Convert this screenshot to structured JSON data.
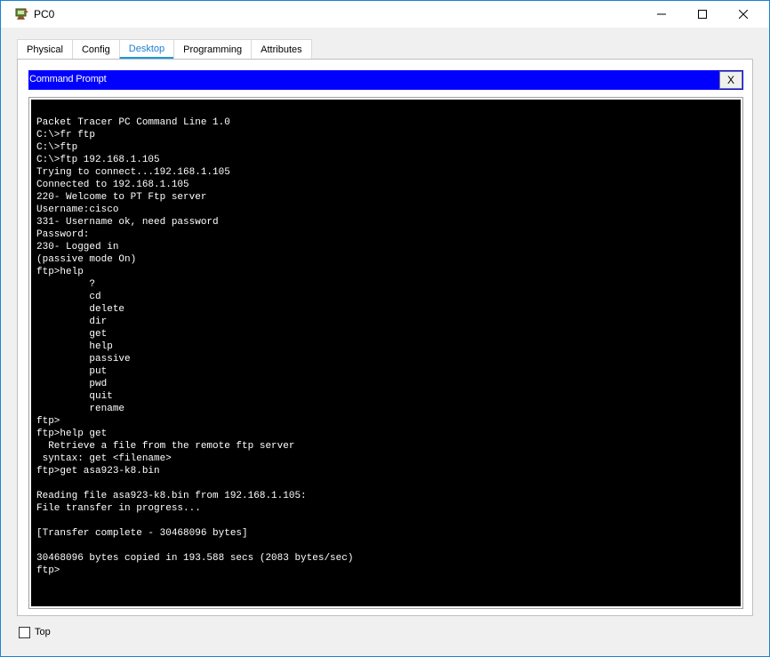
{
  "window": {
    "title": "PC0",
    "controls": {
      "minimize": "minimize-icon",
      "maximize": "maximize-icon",
      "close": "close-icon"
    }
  },
  "tabs": [
    {
      "label": "Physical",
      "active": false
    },
    {
      "label": "Config",
      "active": false
    },
    {
      "label": "Desktop",
      "active": true
    },
    {
      "label": "Programming",
      "active": false
    },
    {
      "label": "Attributes",
      "active": false
    }
  ],
  "command_prompt": {
    "title": "Command Prompt",
    "close_label": "X",
    "lines": [
      "Packet Tracer PC Command Line 1.0",
      "C:\\>fr ftp",
      "C:\\>ftp",
      "C:\\>ftp 192.168.1.105",
      "Trying to connect...192.168.1.105",
      "Connected to 192.168.1.105",
      "220- Welcome to PT Ftp server",
      "Username:cisco",
      "331- Username ok, need password",
      "Password:",
      "230- Logged in",
      "(passive mode On)",
      "ftp>help",
      "         ?",
      "         cd",
      "         delete",
      "         dir",
      "         get",
      "         help",
      "         passive",
      "         put",
      "         pwd",
      "         quit",
      "         rename",
      "ftp>",
      "ftp>help get",
      "  Retrieve a file from the remote ftp server",
      " syntax: get <filename>",
      "ftp>get asa923-k8.bin",
      "",
      "Reading file asa923-k8.bin from 192.168.1.105:",
      "File transfer in progress...",
      "",
      "[Transfer complete - 30468096 bytes]",
      "",
      "30468096 bytes copied in 193.588 secs (2083 bytes/sec)",
      "ftp>"
    ]
  },
  "footer": {
    "top_label": "Top",
    "top_checked": false
  },
  "colors": {
    "cmd_header_bg": "#0000ff",
    "terminal_bg": "#000000",
    "terminal_fg": "#ffffff",
    "active_tab": "#1b7fd0"
  }
}
